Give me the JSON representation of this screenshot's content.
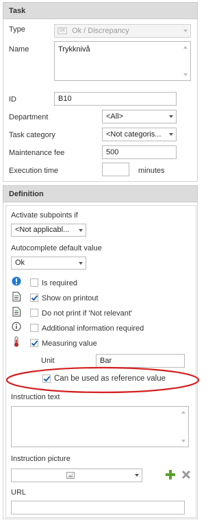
{
  "task_panel": {
    "header": "Task",
    "type_label": "Type",
    "type_value": "Ok / Discrepancy",
    "type_icon_text": "OK",
    "name_label": "Name",
    "name_value": "Trykknivå",
    "id_label": "ID",
    "id_value": "B10",
    "department_label": "Department",
    "department_value": "<All>",
    "category_label": "Task category",
    "category_value": "<Not categoris...",
    "fee_label": "Maintenance fee",
    "fee_value": "500",
    "exec_label": "Execution time",
    "exec_value": "",
    "exec_unit": "minutes"
  },
  "definition_panel": {
    "header": "Definition",
    "activate_label": "Activate subpoints if",
    "activate_value": "<Not applicabl...",
    "autocomplete_label": "Autocomplete default value",
    "autocomplete_value": "Ok",
    "checkboxes": [
      {
        "label": "Is required",
        "checked": false,
        "icon": "exclamation-icon"
      },
      {
        "label": "Show on printout",
        "checked": true,
        "icon": "document-icon"
      },
      {
        "label": "Do not print if 'Not relevant'",
        "checked": false,
        "icon": "document-icon"
      },
      {
        "label": "Additional information required",
        "checked": false,
        "icon": "info-icon"
      },
      {
        "label": "Measuring value",
        "checked": true,
        "icon": "thermometer-icon"
      }
    ],
    "unit_label": "Unit",
    "unit_value": "Bar",
    "reference_label": "Can be used as reference value",
    "reference_checked": true,
    "instruction_text_label": "Instruction text",
    "instruction_text_value": "",
    "instruction_picture_label": "Instruction picture",
    "url_label": "URL",
    "url_value": ""
  },
  "colors": {
    "highlight_ellipse": "#d42020",
    "add_icon": "#5aa02c",
    "remove_icon": "#9a9a9a",
    "info_blue": "#1e7ad6"
  }
}
